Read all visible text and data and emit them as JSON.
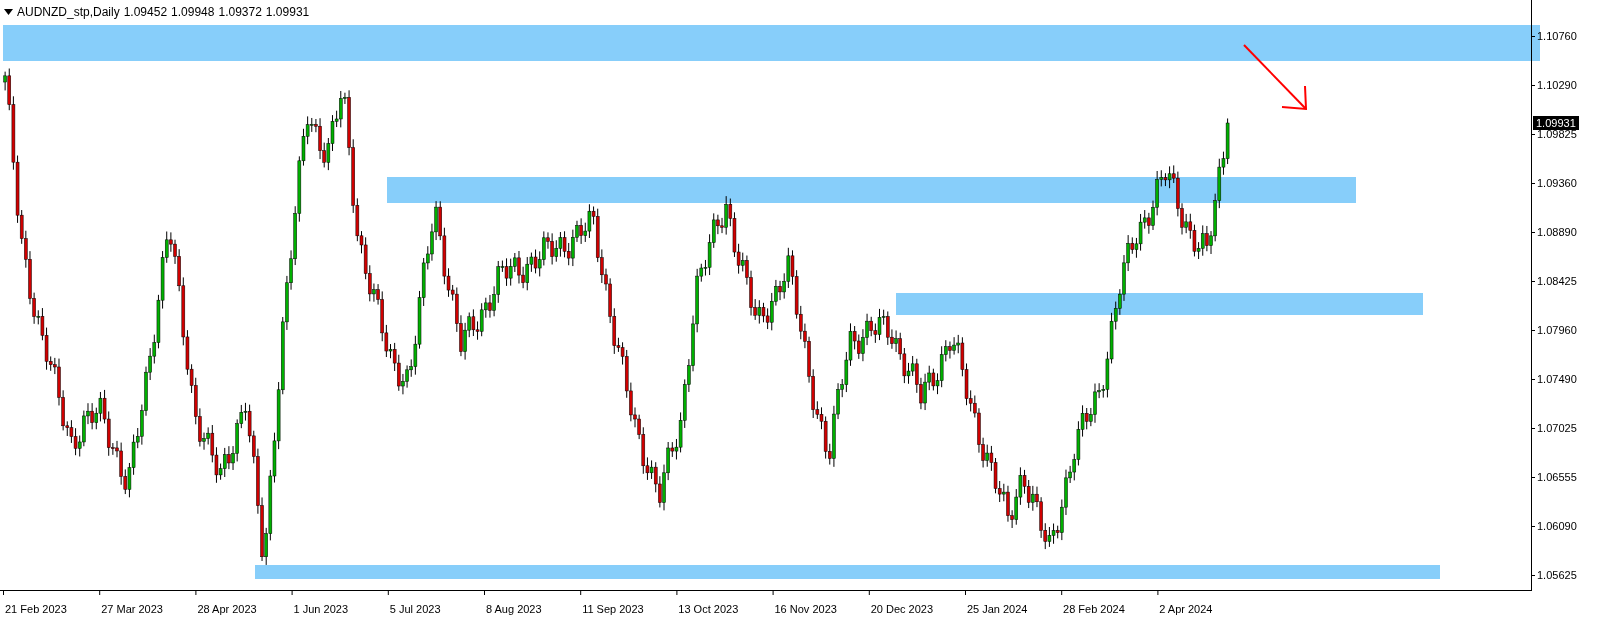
{
  "header": {
    "symbol": "AUDNZD_stp,Daily",
    "quotes": [
      "1.09452",
      "1.09948",
      "1.09372",
      "1.09931"
    ]
  },
  "price_axis": {
    "ticks": [
      "1.10760",
      "1.10290",
      "1.09825",
      "1.09360",
      "1.08890",
      "1.08425",
      "1.07960",
      "1.07490",
      "1.07025",
      "1.06555",
      "1.06090",
      "1.05625"
    ],
    "current_price": "1.09931"
  },
  "date_axis": {
    "labels": [
      "21 Feb 2023",
      "27 Mar 2023",
      "28 Apr 2023",
      "1 Jun 2023",
      "5 Jul 2023",
      "8 Aug 2023",
      "11 Sep 2023",
      "13 Oct 2023",
      "16 Nov 2023",
      "20 Dec 2023",
      "25 Jan 2024",
      "28 Feb 2024",
      "2 Apr 2024"
    ]
  }
}
